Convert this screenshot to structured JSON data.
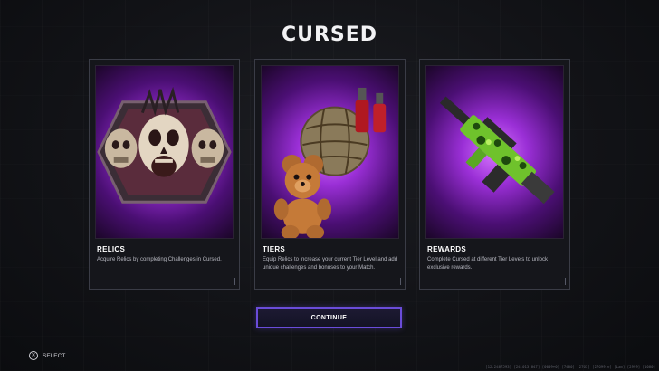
{
  "screen": {
    "title": "CURSED"
  },
  "cards": [
    {
      "label": "RELICS",
      "description": "Acquire Relics by completing Challenges in Cursed."
    },
    {
      "label": "TIERS",
      "description": "Equip Relics to increase your current Tier Level and add unique challenges and bonuses to your Match."
    },
    {
      "label": "REWARDS",
      "description": "Complete Cursed at different Tier Levels to unlock exclusive rewards."
    }
  ],
  "actions": {
    "continue_label": "CONTINUE"
  },
  "footer": {
    "select_glyph": "✕",
    "select_label": "SELECT",
    "build_id": "[12.2487593] [24.013.847] [0009+0] [7480] [2763] [27699.e] [Lam] [2999] [1080]"
  },
  "colors": {
    "accent": "#6a4cd9",
    "art_purple": "#9a2fd6",
    "camo_green": "#7fd33a"
  },
  "icons": {
    "select_button": "cross-button-icon"
  }
}
